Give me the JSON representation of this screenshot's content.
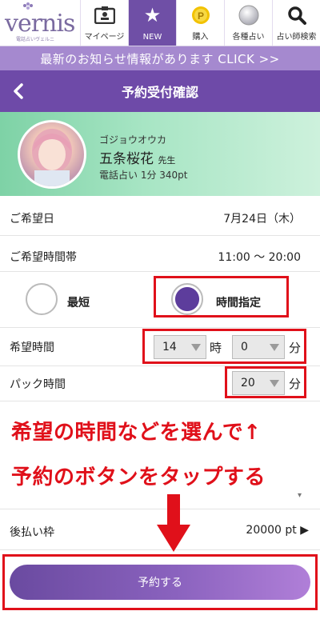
{
  "header": {
    "logo": "vernis",
    "logo_sub": "電話占いヴェルニ",
    "nav": [
      {
        "label": "マイページ",
        "icon": "id-card-icon"
      },
      {
        "label": "NEW",
        "icon": "star-icon"
      },
      {
        "label": "購入",
        "icon": "coin-icon"
      },
      {
        "label": "各種占い",
        "icon": "crystal-ball-icon"
      },
      {
        "label": "占い師検索",
        "icon": "search-icon"
      }
    ]
  },
  "notice": "最新のお知らせ情報があります CLICK >>",
  "page_title": "予約受付確認",
  "profile": {
    "kana": "ゴジョウオウカ",
    "name": "五条桜花",
    "honorific": "先生",
    "tel_rate": "電話占い 1分 340pt"
  },
  "form": {
    "date_label": "ご希望日",
    "date_value": "7月24日（木）",
    "timeslot_label": "ご希望時間帯",
    "timeslot_value": "11:00 〜 20:00",
    "option_shortest": "最短",
    "option_specified": "時間指定",
    "selected_option": "時間指定",
    "desired_time_label": "希望時間",
    "hour_value": "14",
    "hour_unit": "時",
    "minute_value": "0",
    "minute_unit": "分",
    "pack_label": "パック時間",
    "pack_value": "20",
    "pack_unit": "分",
    "postpay_label": "後払い枠",
    "postpay_value": "20000 pt ▶"
  },
  "annotation": {
    "line1": "希望の時間などを選んで↑",
    "line2": "予約のボタンをタップする"
  },
  "reserve_button": "予約する",
  "colors": {
    "header_purple": "#6e4aa8",
    "notice_purple": "#a589cf",
    "annotation_red": "#e0101a",
    "banner_green": "#7ed2a6"
  }
}
